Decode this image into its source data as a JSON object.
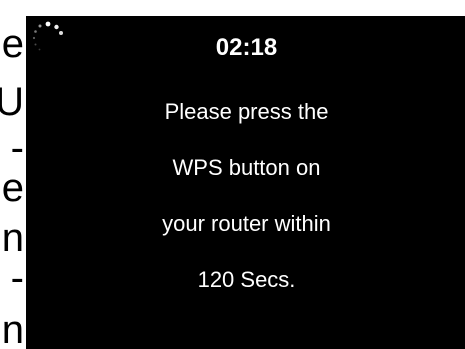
{
  "colors": {
    "screen_background": "#000000",
    "text": "#ffffff",
    "page_background": "#ffffff"
  },
  "left_edge_fragments": [
    "e",
    "U",
    "-",
    "e",
    "n",
    "-",
    "n"
  ],
  "spinner": {
    "icon": "loading-spinner-icon"
  },
  "timer": {
    "countdown": "02:18"
  },
  "message": {
    "lines": [
      "Please press the",
      "WPS button on",
      "your router within",
      "120 Secs."
    ]
  }
}
